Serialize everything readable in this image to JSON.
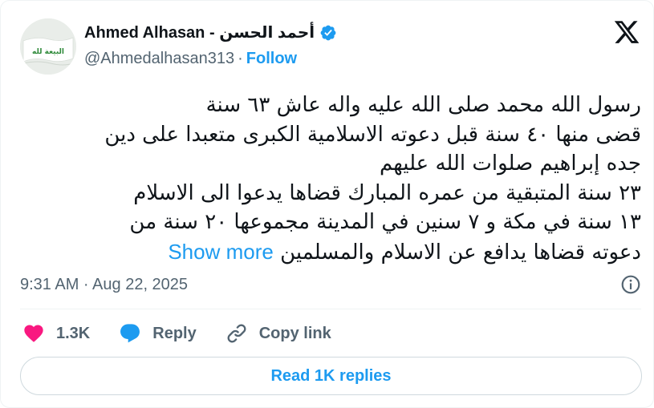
{
  "author": {
    "display_name": "Ahmed Alhasan - أحمد الحسن",
    "handle": "@Ahmedalhasan313",
    "separator": "·",
    "follow_label": "Follow",
    "avatar_text": "البيعة لله",
    "verified_color": "#1d9bf0"
  },
  "tweet": {
    "lines": [
      "رسول الله محمد صلى الله عليه واله عاش ٦٣ سنة",
      "قضى منها ٤٠ سنة قبل دعوته الاسلامية الكبرى متعبدا على دين",
      "جده إبراهيم صلوات الله عليهم",
      "٢٣ سنة المتبقية من عمره المبارك قضاها يدعوا الى الاسلام",
      "١٣ سنة في مكة و ٧ سنين في المدينة مجموعها ٢٠ سنة من",
      "دعوته قضاها يدافع عن الاسلام والمسلمين"
    ],
    "show_more": "Show more",
    "timestamp": "9:31 AM · Aug 22, 2025"
  },
  "actions": {
    "like_count": "1.3K",
    "reply_label": "Reply",
    "copy_link_label": "Copy link"
  },
  "read_replies_label": "Read 1K replies",
  "colors": {
    "accent": "#1d9bf0",
    "like": "#f91880",
    "text": "#0f1419",
    "muted": "#536471"
  }
}
